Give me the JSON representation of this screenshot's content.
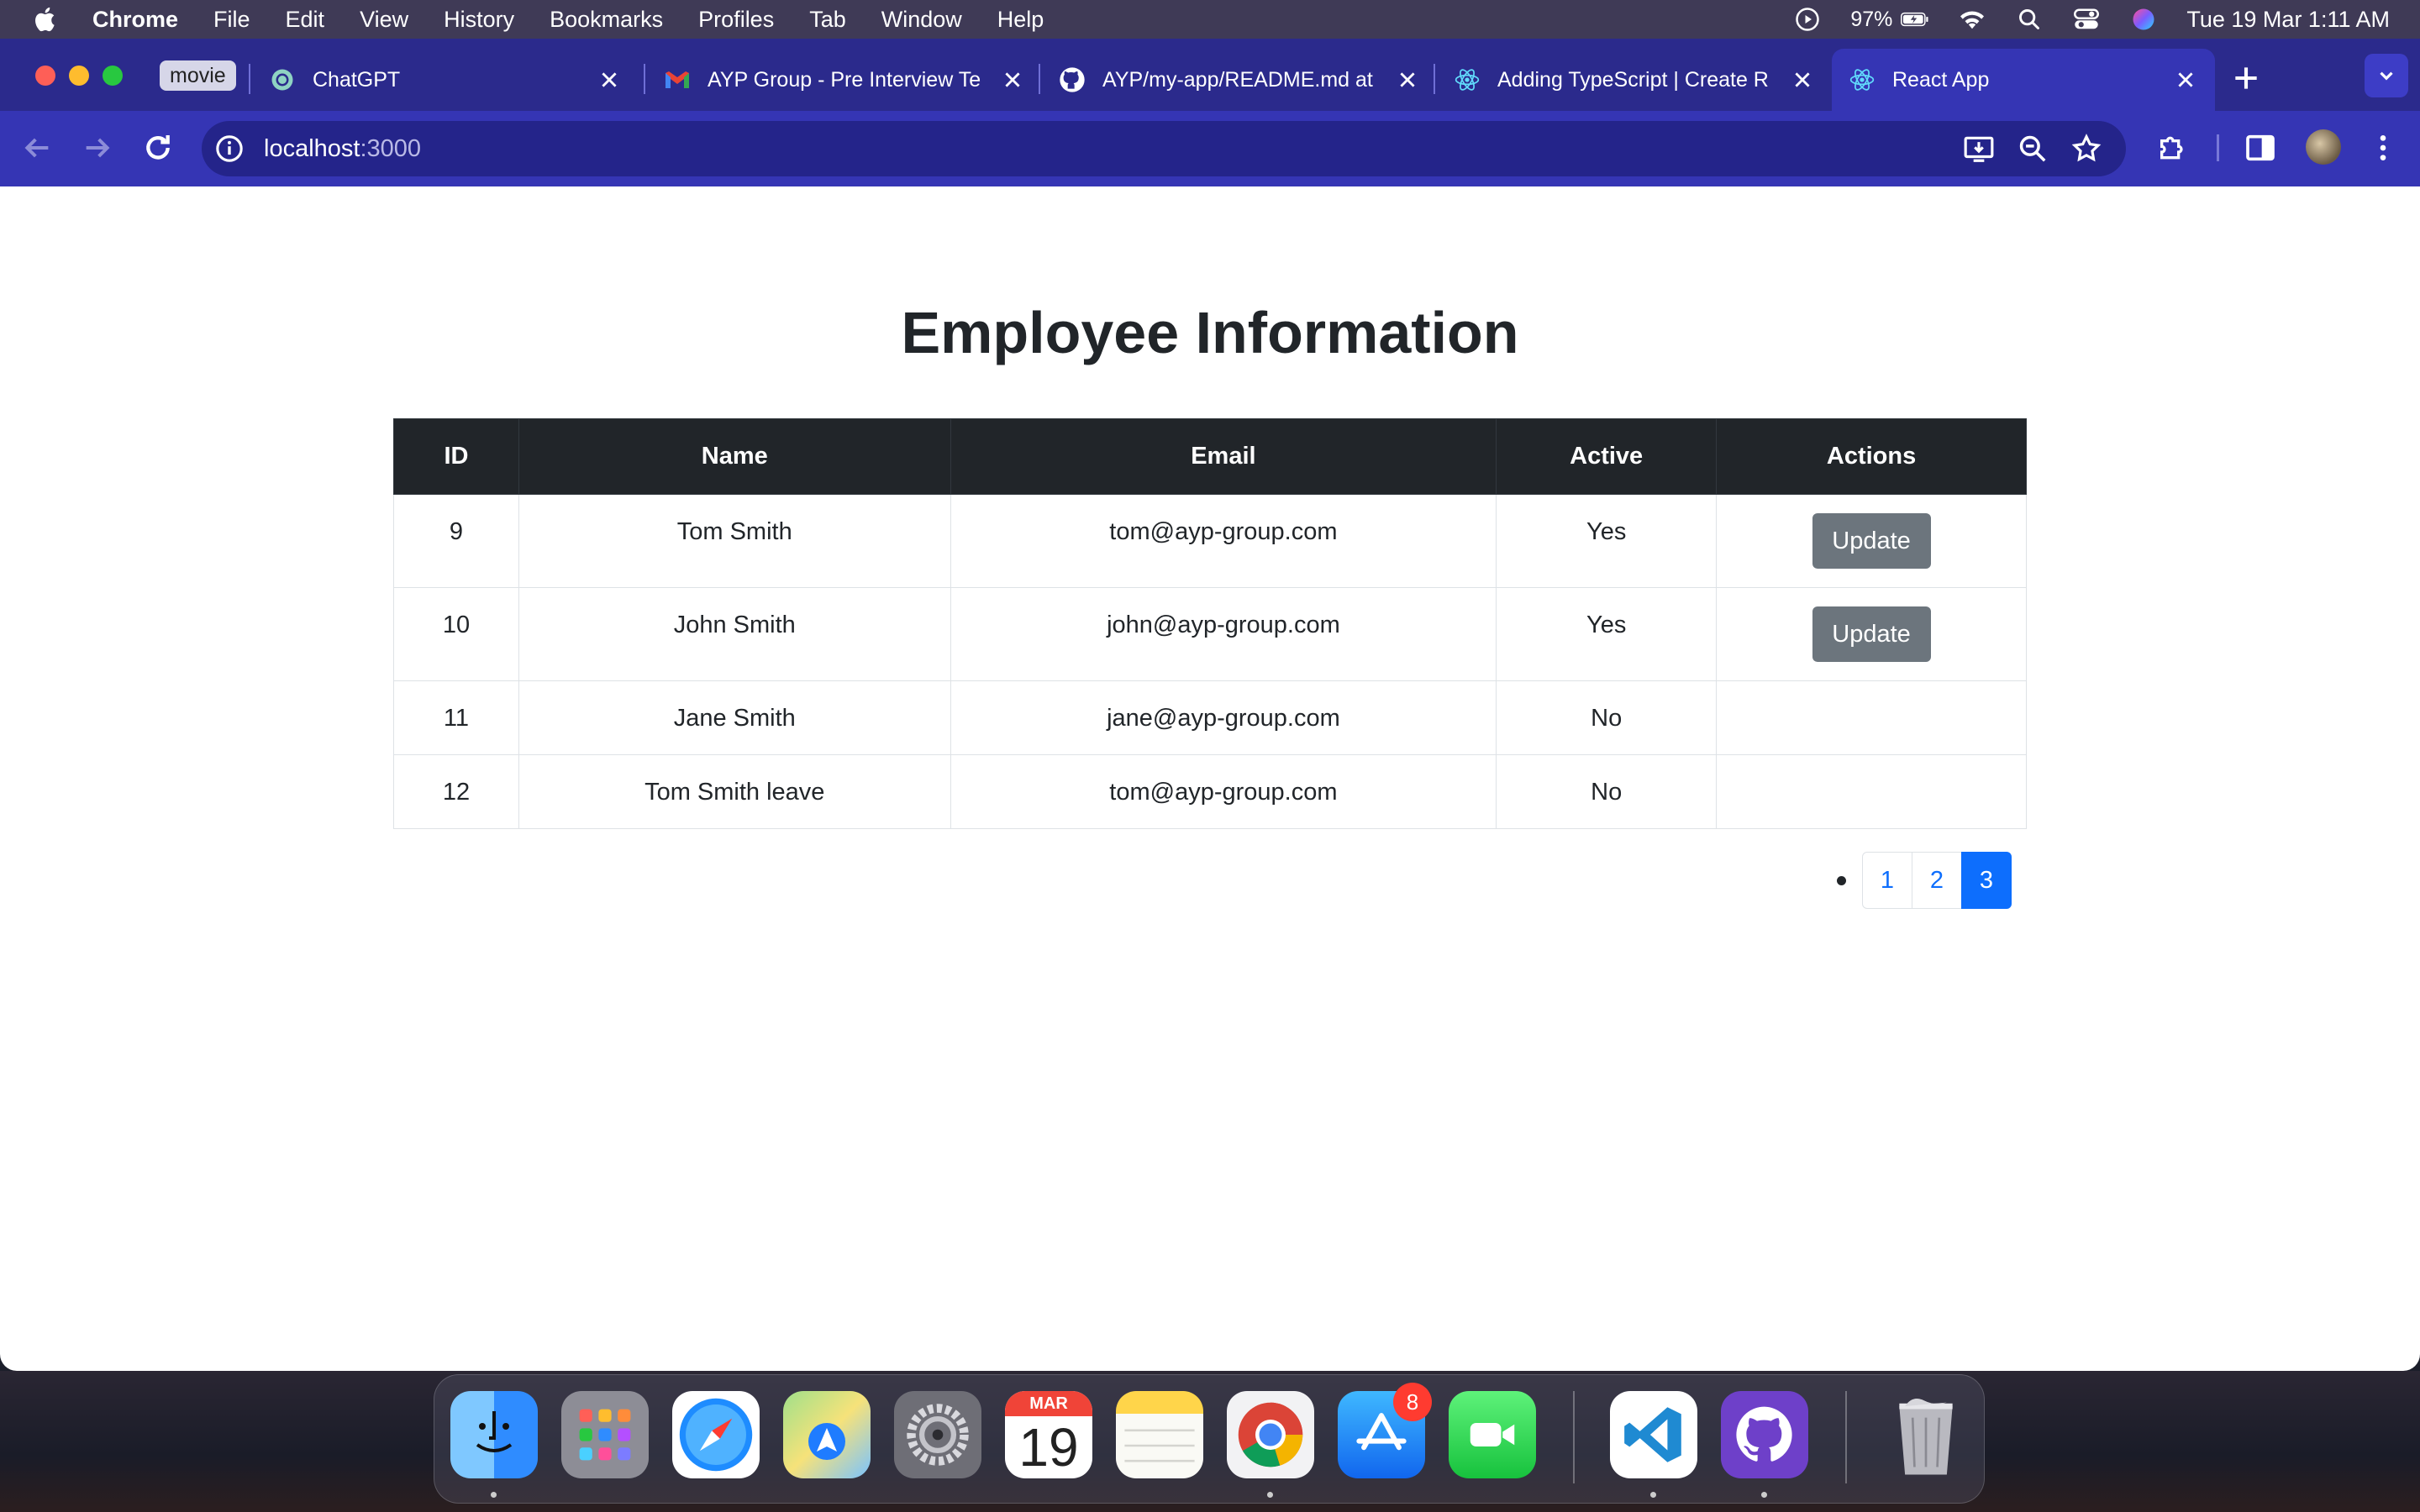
{
  "menubar": {
    "app_name": "Chrome",
    "items": [
      "File",
      "Edit",
      "View",
      "History",
      "Bookmarks",
      "Profiles",
      "Tab",
      "Window",
      "Help"
    ],
    "battery": "97%",
    "datetime": "Tue 19 Mar  1:11 AM"
  },
  "browser": {
    "tab_group": "movie",
    "tabs": [
      {
        "title": "ChatGPT",
        "icon": "openai-icon"
      },
      {
        "title": "AYP Group - Pre Interview Te",
        "icon": "gmail-icon"
      },
      {
        "title": "AYP/my-app/README.md at",
        "icon": "github-icon"
      },
      {
        "title": "Adding TypeScript | Create R",
        "icon": "react-icon"
      },
      {
        "title": "React App",
        "icon": "react-icon",
        "active": true
      }
    ],
    "address": {
      "host": "localhost",
      "port": ":3000"
    }
  },
  "page": {
    "title": "Employee Information",
    "table": {
      "headers": [
        "ID",
        "Name",
        "Email",
        "Active",
        "Actions"
      ],
      "rows": [
        {
          "id": "9",
          "name": "Tom Smith",
          "email": "tom@ayp-group.com",
          "active": "Yes",
          "action": "Update"
        },
        {
          "id": "10",
          "name": "John Smith",
          "email": "john@ayp-group.com",
          "active": "Yes",
          "action": "Update"
        },
        {
          "id": "11",
          "name": "Jane Smith",
          "email": "jane@ayp-group.com",
          "active": "No",
          "action": ""
        },
        {
          "id": "12",
          "name": "Tom Smith leave",
          "email": "tom@ayp-group.com",
          "active": "No",
          "action": ""
        }
      ]
    },
    "pagination": {
      "pages": [
        "1",
        "2",
        "3"
      ],
      "current": "3"
    }
  },
  "dock": {
    "calendar_month": "MAR",
    "calendar_day": "19",
    "appstore_badge": "8"
  },
  "colors": {
    "tab_strip": "#2b2a8c",
    "toolbar": "#3535b4",
    "table_header": "#212529",
    "update_button": "#6c757d",
    "pager_active": "#0d6efd"
  }
}
